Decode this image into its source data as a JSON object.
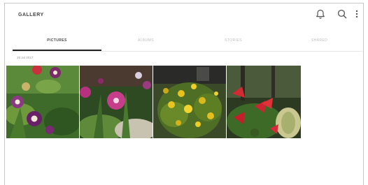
{
  "header": {
    "title": "GALLERY",
    "icons": [
      "bell-icon",
      "search-icon",
      "more-vert-icon"
    ]
  },
  "tabs": [
    {
      "label": "PICTURES",
      "active": true
    },
    {
      "label": "ALBUMS",
      "active": false
    },
    {
      "label": "STORIES",
      "active": false
    },
    {
      "label": "SHARED",
      "active": false
    }
  ],
  "section": {
    "date": "28 Jul 2017"
  },
  "photos": [
    {
      "subject": "purple columbine flowers"
    },
    {
      "subject": "pink wildflowers"
    },
    {
      "subject": "yellow flowering shrub"
    },
    {
      "subject": "red anthurium flowers"
    }
  ],
  "colors": {
    "active_tab": "#4a4a4a",
    "inactive_tab": "#bdbdbd",
    "underline": "#222222"
  }
}
